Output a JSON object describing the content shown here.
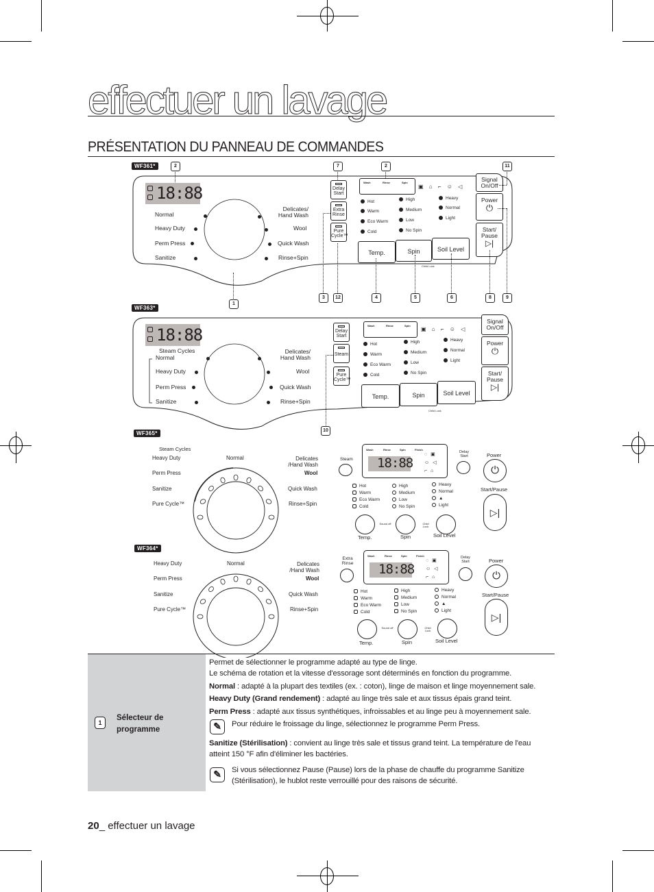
{
  "page": {
    "title": "effectuer un lavage",
    "section_title": "PRÉSENTATION DU PANNEAU DE COMMANDES",
    "footer": {
      "page_number": "20",
      "separator": "_ ",
      "text": "effectuer un lavage"
    }
  },
  "panels": {
    "wf361": {
      "model": "WF361*",
      "display": "18:88",
      "cycles_left": [
        "Normal",
        "Heavy Duty",
        "Perm Press",
        "Sanitize"
      ],
      "cycles_right": [
        "Delicates/ Hand Wash",
        "Wool",
        "Quick Wash",
        "Rinse+Spin"
      ],
      "option_buttons": [
        "Delay Start",
        "Extra Rinse",
        "Pure Cycle™"
      ],
      "status_bar": [
        "Wash",
        "Rinse",
        "Spin"
      ],
      "temp_options": [
        "Hot",
        "Warm",
        "Eco Warm",
        "Cold"
      ],
      "spin_options": [
        "High",
        "Medium",
        "Low",
        "No Spin"
      ],
      "soil_options": [
        "Heavy",
        "Normal",
        "Light"
      ],
      "bottom_buttons": [
        "Temp.",
        "Spin",
        "Soil Level"
      ],
      "child_lock": "Child Lock",
      "right_buttons": [
        "Signal On/Off",
        "Power",
        "Start/ Pause"
      ],
      "callouts_top": [
        "2",
        "7",
        "2",
        "11"
      ],
      "callouts_bottom": [
        "1",
        "3",
        "12",
        "4",
        "5",
        "6",
        "8",
        "9"
      ]
    },
    "wf363": {
      "model": "WF363*",
      "display": "18:88",
      "steam_label": "Steam Cycles",
      "cycles_left": [
        "Normal",
        "Heavy Duty",
        "Perm Press",
        "Sanitize"
      ],
      "cycles_right": [
        "Delicates/ Hand Wash",
        "Wool",
        "Quick Wash",
        "Rinse+Spin"
      ],
      "option_buttons": [
        "Delay Start",
        "Steam",
        "Pure Cycle™"
      ],
      "status_bar": [
        "Wash",
        "Rinse",
        "Spin"
      ],
      "temp_options": [
        "Hot",
        "Warm",
        "Eco Warm",
        "Cold"
      ],
      "spin_options": [
        "High",
        "Medium",
        "Low",
        "No Spin"
      ],
      "soil_options": [
        "Heavy",
        "Normal",
        "Light"
      ],
      "bottom_buttons": [
        "Temp.",
        "Spin",
        "Soil Level"
      ],
      "child_lock": "Child Lock",
      "right_buttons": [
        "Signal On/Off",
        "Power",
        "Start/ Pause"
      ],
      "callout": "10"
    },
    "wf365": {
      "model": "WF365*",
      "steam_label": "Steam Cycles",
      "dial_left": [
        "Heavy Duty",
        "Perm Press",
        "Sanitize",
        "Pure Cycle™"
      ],
      "dial_top": "Normal",
      "dial_right": [
        "Delicates /Hand Wash",
        "Wool",
        "Quick Wash",
        "Rinse+Spin"
      ],
      "left_button": "Steam",
      "status_bar": [
        "Wash",
        "Rinse",
        "Spin",
        "Finish"
      ],
      "display": "18:88",
      "delay_button": "Delay Start",
      "power_label": "Power",
      "start_label": "Start/Pause",
      "temp_options": [
        "Hot",
        "Warm",
        "Eco Warm",
        "Cold"
      ],
      "spin_options": [
        "High",
        "Medium",
        "Low",
        "No Spin"
      ],
      "soil_options": [
        "Heavy",
        "Normal",
        "▲",
        "Light"
      ],
      "bottom_buttons": [
        "Temp.",
        "Spin",
        "Soil Level"
      ],
      "link_1": "Sound off",
      "link_2": "Child Lock"
    },
    "wf364": {
      "model": "WF364*",
      "dial_left": [
        "Heavy Duty",
        "Perm Press",
        "Sanitize",
        "Pure Cycle™"
      ],
      "dial_top": "Normal",
      "dial_right": [
        "Delicates /Hand Wash",
        "Wool",
        "Quick Wash",
        "Rinse+Spin"
      ],
      "left_button": "Extra Rinse",
      "status_bar": [
        "Wash",
        "Rinse",
        "Spin",
        "Finish"
      ],
      "display": "18:88",
      "delay_button": "Delay Start",
      "power_label": "Power",
      "start_label": "Start/Pause",
      "temp_options": [
        "Hot",
        "Warm",
        "Eco Warm",
        "Cold"
      ],
      "spin_options": [
        "High",
        "Medium",
        "Low",
        "No Spin"
      ],
      "soil_options": [
        "Heavy",
        "Normal",
        "▲",
        "Light"
      ],
      "bottom_buttons": [
        "Temp.",
        "Spin",
        "Soil Level"
      ],
      "link_1": "Sound off",
      "link_2": "Child Lock"
    }
  },
  "table": {
    "rows": [
      {
        "number": "1",
        "label": "Sélecteur de programme",
        "intro_1": "Permet de sélectionner le programme adapté au type de linge.",
        "intro_2": "Le schéma de rotation et la vitesse d'essorage sont déterminés en fonction du programme.",
        "normal_term": "Normal",
        "normal_text": " : adapté à la plupart des textiles (ex. : coton), linge de maison et linge moyennement sale.",
        "heavy_term": "Heavy Duty (Grand rendement)",
        "heavy_text": " : adapté au linge très sale et aux tissus épais grand teint.",
        "perm_term": "Perm Press",
        "perm_text": " : adapté aux tissus synthétiques, infroissables et au linge peu à moyennement sale.",
        "note_1": "Pour réduire le froissage du linge, sélectionnez le programme Perm Press.",
        "sanitize_term": "Sanitize (Stérilisation)",
        "sanitize_text": " : convient au linge très sale et tissus grand teint. La température de l'eau atteint 150 °F afin d'éliminer les bactéries.",
        "note_2": "Si vous sélectionnez Pause (Pause) lors de la phase de chauffe du programme Sanitize (Stérilisation), le hublot reste verrouillé pour des raisons de sécurité."
      }
    ]
  },
  "icons": {
    "note": "note-pencil-icon",
    "power": "power-icon",
    "start_pause": "play-pause-icon"
  }
}
